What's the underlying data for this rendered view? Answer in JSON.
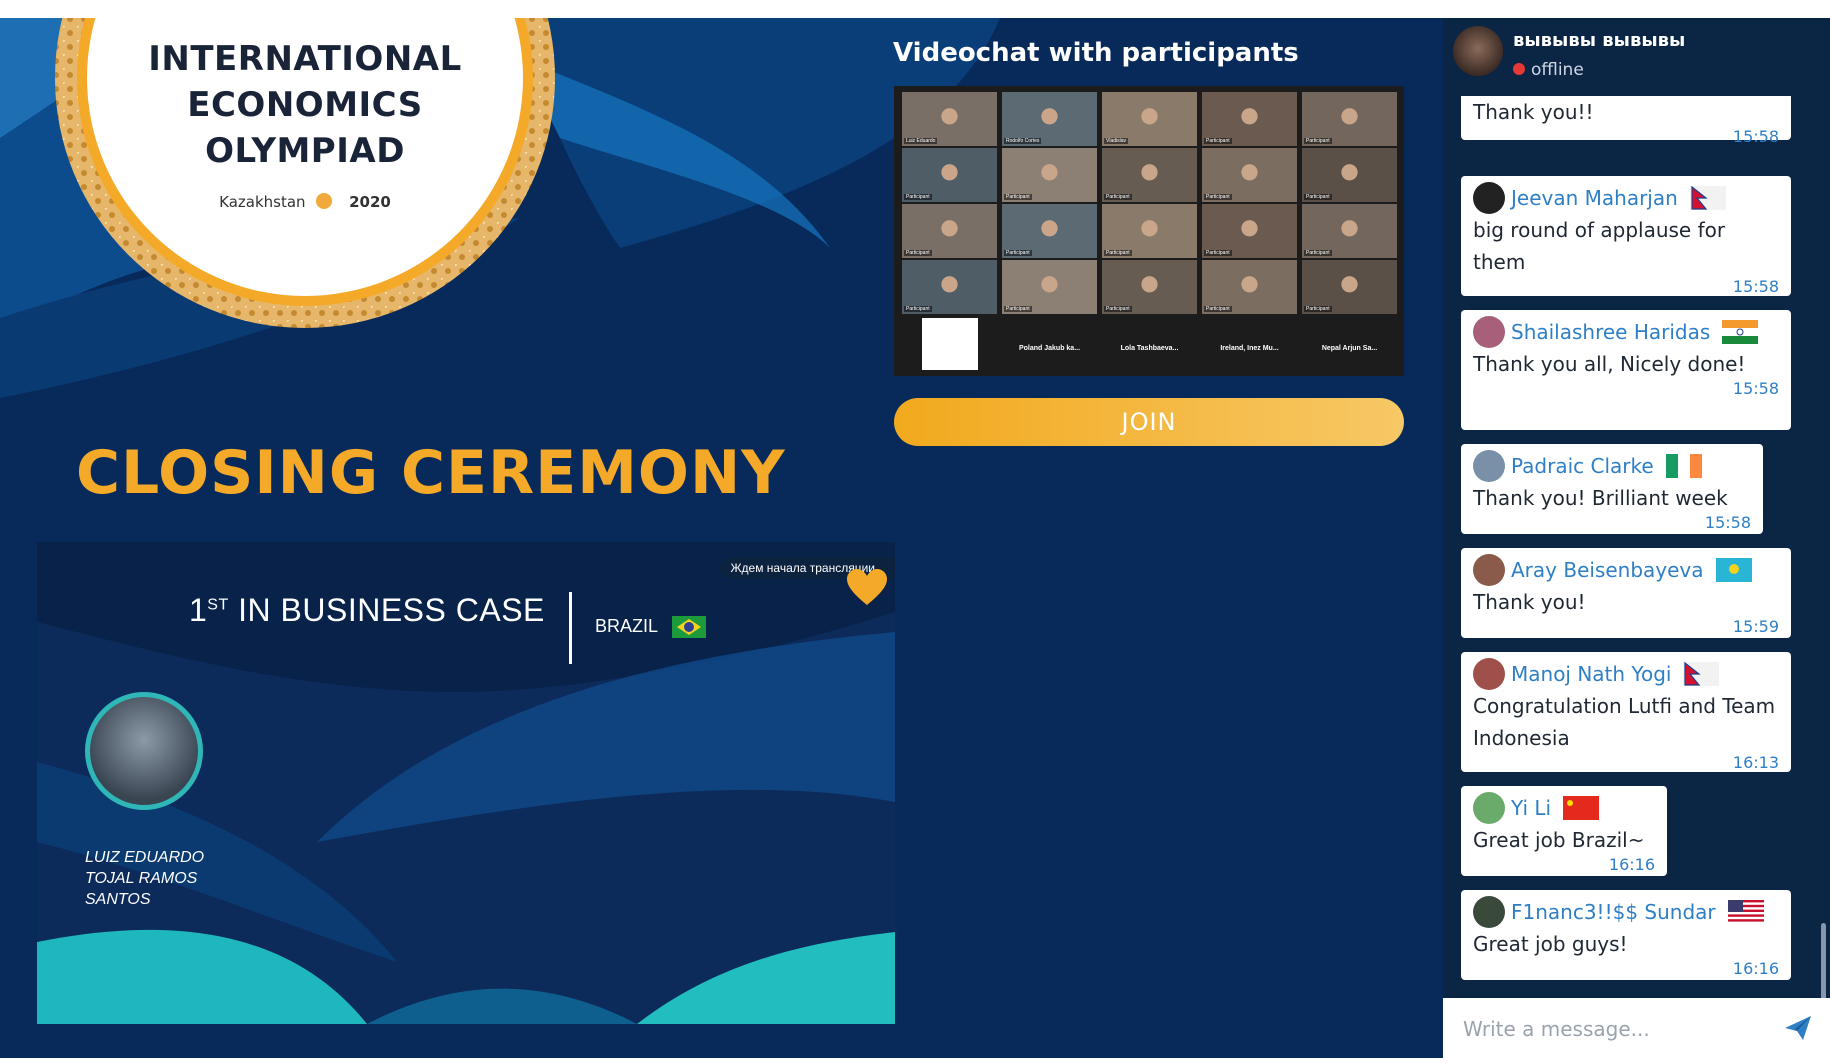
{
  "logo": {
    "title_lines": [
      "INTERNATIONAL",
      "ECONOMICS",
      "OLYMPIAD"
    ],
    "country": "Kazakhstan",
    "year": "2020"
  },
  "headline": "CLOSING CEREMONY",
  "stream": {
    "award_rank": "1",
    "award_rank_suffix": "ST",
    "award_text": "IN BUSINESS CASE",
    "country": "BRAZIL",
    "waiting_text": "Ждем начала трансляции",
    "winner_name": "LUIZ EDUARDO TOJAL RAMOS SANTOS"
  },
  "videochat": {
    "title": "Videochat with participants",
    "join_label": "JOIN",
    "tiles": [
      {
        "caption": "Luiz Eduardo"
      },
      {
        "caption": "Rodolfo Cortes"
      },
      {
        "caption": "Vladislav"
      },
      {
        "caption": "Participant"
      },
      {
        "caption": "Participant"
      },
      {
        "caption": "Participant"
      },
      {
        "caption": "Participant"
      },
      {
        "caption": "Participant"
      },
      {
        "caption": "Participant"
      },
      {
        "caption": "Participant"
      },
      {
        "caption": "Participant"
      },
      {
        "caption": "Participant"
      },
      {
        "caption": "Participant"
      },
      {
        "caption": "Participant"
      },
      {
        "caption": "Participant"
      },
      {
        "caption": "Participant"
      },
      {
        "caption": "Participant"
      },
      {
        "caption": "Participant"
      },
      {
        "caption": "Participant"
      },
      {
        "caption": "Participant"
      },
      {
        "caption": ""
      },
      {
        "caption": "Poland Jakub ka..."
      },
      {
        "caption": "Lola Tashbaeva..."
      },
      {
        "caption": "Ireland, Inez Mu..."
      },
      {
        "caption": "Nepal Arjun Sa..."
      }
    ]
  },
  "chat": {
    "header_name": "вывывы вывывы",
    "header_status": "offline",
    "placeholder": "Write a message...",
    "messages": [
      {
        "name": "",
        "text": "Thank you!!",
        "time": "15:58",
        "flag": "",
        "avatar": ""
      },
      {
        "name": "Jeevan Maharjan",
        "text": "big round of applause for them",
        "time": "15:58",
        "flag": "nepal",
        "avatar": "#222222"
      },
      {
        "name": "Shailashree Haridas",
        "text": "Thank you all, Nicely done!",
        "time": "15:58",
        "flag": "india",
        "avatar": "#a8607a"
      },
      {
        "name": "Padraic Clarke",
        "text": "Thank you! Brilliant week",
        "time": "15:58",
        "flag": "ireland",
        "avatar": "#7a90a8"
      },
      {
        "name": "Aray Beisenbayeva",
        "text": "Thank you!",
        "time": "15:59",
        "flag": "kazakhstan",
        "avatar": "#8a5a4a"
      },
      {
        "name": "Manoj Nath Yogi",
        "text": "Congratulation Lutfi and Team Indonesia",
        "time": "16:13",
        "flag": "nepal",
        "avatar": "#a0504a"
      },
      {
        "name": "Yi Li",
        "text": "Great job Brazil~",
        "time": "16:16",
        "flag": "china",
        "avatar": "#6aaa6a"
      },
      {
        "name": "F1nanc3!!$$ Sundar",
        "text": "Great job guys!",
        "time": "16:16",
        "flag": "usa",
        "avatar": "#3a4a3a"
      }
    ]
  },
  "colors": {
    "accent_gold": "#f5a928",
    "chat_link": "#2f7fc6",
    "background_navy": "#072a5a"
  }
}
